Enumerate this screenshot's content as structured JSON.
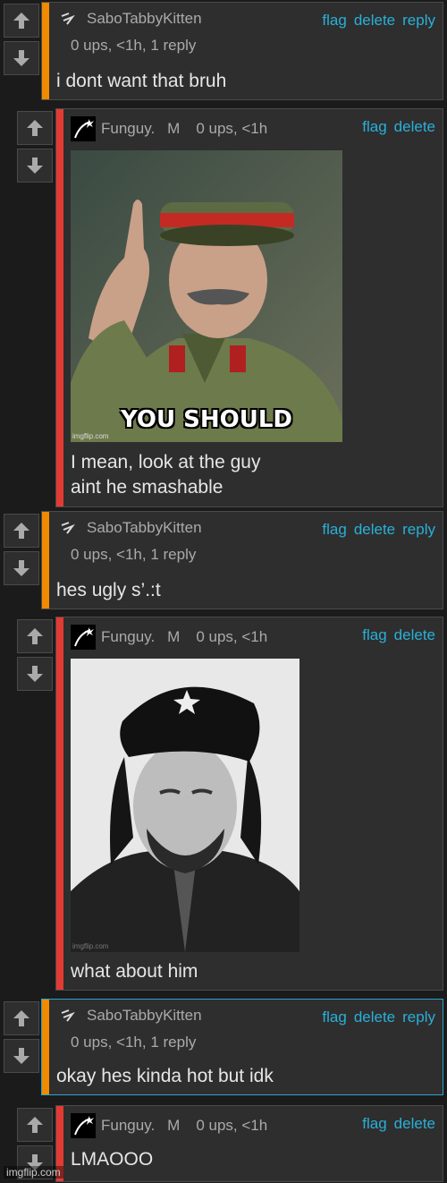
{
  "actions": {
    "flag": "flag",
    "delete": "delete",
    "reply": "reply"
  },
  "comments": [
    {
      "user": "SaboTabbyKitten",
      "meta": "0 ups, <1h, 1 reply",
      "text": "i dont want that bruh"
    },
    {
      "user": "Funguy.",
      "mod": "M",
      "meta": "0 ups, <1h",
      "image_caption": "YOU SHOULD",
      "image_watermark": "imgflip.com",
      "text1": "I mean, look at the guy",
      "text2": "aint he smashable"
    },
    {
      "user": "SaboTabbyKitten",
      "meta": "0 ups, <1h, 1 reply",
      "text": "hes ugly s’.:t"
    },
    {
      "user": "Funguy.",
      "mod": "M",
      "meta": "0 ups, <1h",
      "image_watermark": "imgflip.com",
      "text": "what about him"
    },
    {
      "user": "SaboTabbyKitten",
      "meta": "0 ups, <1h, 1 reply",
      "text": "okay hes kinda hot but idk"
    },
    {
      "user": "Funguy.",
      "mod": "M",
      "meta": "0 ups, <1h",
      "text": "LMAOOO"
    }
  ],
  "watermark": "imgflip.com",
  "colors": {
    "accent_orange": "#f08a00",
    "accent_red": "#e23b33",
    "link": "#29b0d8",
    "highlight_border": "#2aa7c9"
  }
}
